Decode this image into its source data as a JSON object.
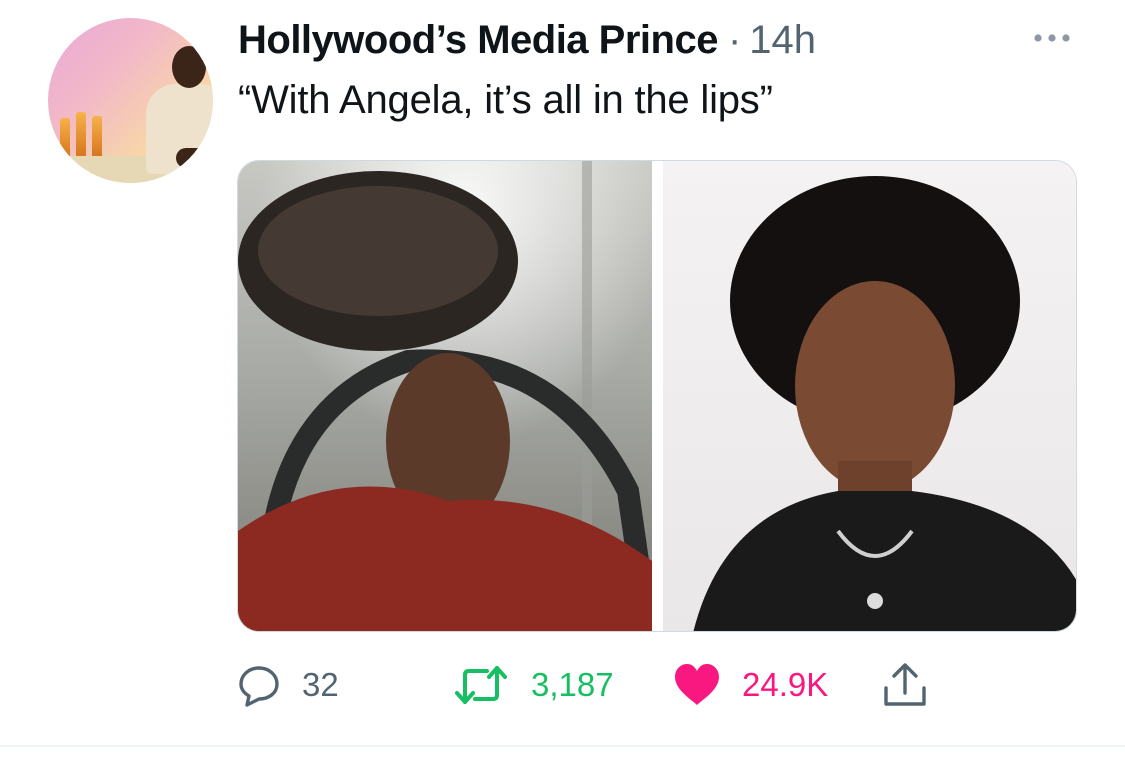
{
  "tweet": {
    "display_name": "Hollywood’s Media Prince",
    "separator": "·",
    "time": "14h",
    "text": "“With Angela, it’s all in the lips”",
    "avatar_icon": "user-avatar",
    "more_icon": "more-horizontal-icon"
  },
  "actions": {
    "reply_count": "32",
    "retweet_count": "3,187",
    "like_count": "24.9K",
    "reply_icon": "reply-bubble-icon",
    "retweet_icon": "retweet-icon",
    "like_icon": "heart-filled-icon",
    "share_icon": "share-upload-icon"
  },
  "colors": {
    "retweet": "#17bf63",
    "like": "#f91880",
    "muted": "#536471",
    "text": "#0f1419"
  }
}
